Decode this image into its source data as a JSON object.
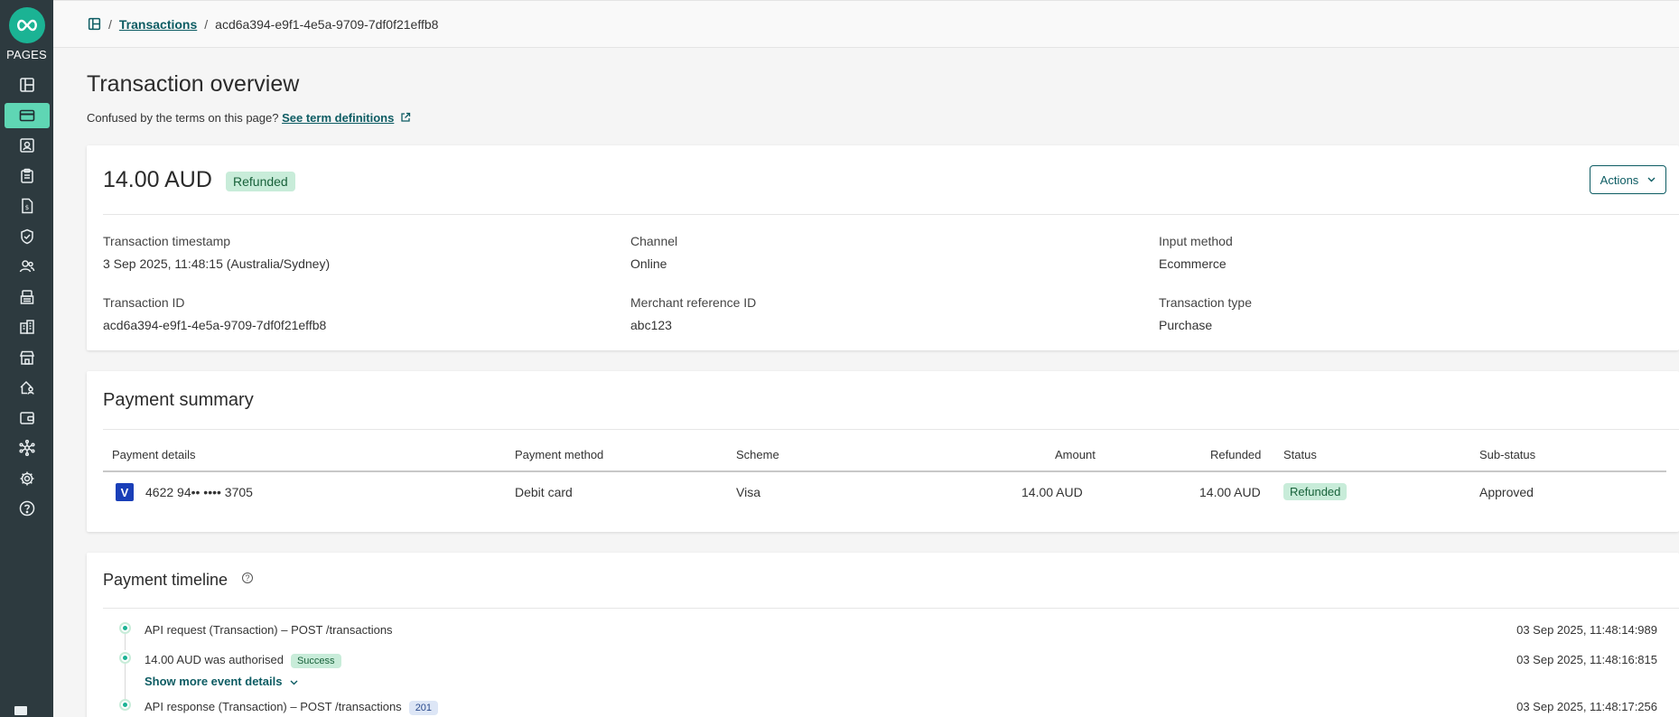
{
  "sidebar": {
    "brand": "PAGES",
    "items": [
      {
        "icon": "dashboard-icon"
      },
      {
        "icon": "credit-card-icon",
        "active": true
      },
      {
        "icon": "contact-card-icon"
      },
      {
        "icon": "clipboard-icon"
      },
      {
        "icon": "invoice-icon"
      },
      {
        "icon": "shield-check-icon"
      },
      {
        "icon": "users-icon"
      },
      {
        "icon": "terminal-icon"
      },
      {
        "icon": "buildings-icon"
      },
      {
        "icon": "store-icon"
      },
      {
        "icon": "home-user-icon"
      },
      {
        "icon": "wallet-icon"
      },
      {
        "icon": "network-icon"
      },
      {
        "icon": "gear-icon"
      },
      {
        "icon": "help-icon"
      }
    ]
  },
  "breadcrumb": {
    "separator": "/",
    "link": "Transactions",
    "current": "acd6a394-e9f1-4e5a-9709-7df0f21effb8"
  },
  "page": {
    "title": "Transaction overview",
    "terms_prefix": "Confused by the terms on this page?",
    "terms_link": "See term definitions"
  },
  "overview": {
    "amount": "14.00 AUD",
    "status": "Refunded",
    "actions_label": "Actions",
    "fields": [
      {
        "label": "Transaction timestamp",
        "value": "3 Sep 2025, 11:48:15 (Australia/Sydney)"
      },
      {
        "label": "Channel",
        "value": "Online"
      },
      {
        "label": "Input method",
        "value": "Ecommerce"
      },
      {
        "label": "Transaction ID",
        "value": "acd6a394-e9f1-4e5a-9709-7df0f21effb8"
      },
      {
        "label": "Merchant reference ID",
        "value": "abc123"
      },
      {
        "label": "Transaction type",
        "value": "Purchase"
      }
    ]
  },
  "payment_summary": {
    "title": "Payment summary",
    "columns": [
      "Payment details",
      "Payment method",
      "Scheme",
      "Amount",
      "Refunded",
      "Status",
      "Sub-status"
    ],
    "row": {
      "card_brand_letter": "V",
      "card_number": "4622 94•• •••• 3705",
      "method": "Debit card",
      "scheme": "Visa",
      "amount": "14.00 AUD",
      "refunded": "14.00 AUD",
      "status": "Refunded",
      "sub_status": "Approved"
    }
  },
  "timeline": {
    "title": "Payment timeline",
    "events": [
      {
        "text": "API request (Transaction) – POST /transactions",
        "time": "03 Sep 2025, 11:48:14:989"
      },
      {
        "text": "14.00 AUD was authorised",
        "badge": "Success",
        "time": "03 Sep 2025, 11:48:16:815"
      },
      {
        "text": "API response (Transaction) – POST /transactions",
        "badge": "201",
        "time": "03 Sep 2025, 11:48:17:256"
      }
    ],
    "show_more": "Show more event details"
  },
  "colors": {
    "sidebar_bg": "#2d3a3f",
    "accent": "#1bb394",
    "active_nav": "#5fd6b4",
    "link": "#0d5c63",
    "success_badge_bg": "#c8ecd9"
  }
}
